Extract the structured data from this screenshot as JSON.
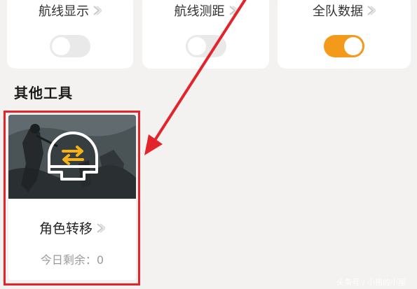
{
  "toggles": [
    {
      "label": "航线显示",
      "state": "off"
    },
    {
      "label": "航线测距",
      "state": "off"
    },
    {
      "label": "全队数据",
      "state": "on"
    }
  ],
  "section": {
    "title": "其他工具"
  },
  "tool": {
    "label": "角色转移",
    "remaining": "今日剩余：0"
  },
  "watermark": "头条号 / 小猪的小屋",
  "colors": {
    "accent": "#f39a1a",
    "highlight": "#e3242b",
    "background": "#f3f2f0"
  },
  "icons": {
    "chevron": "chevron-right-icon",
    "transfer": "helmet-transfer-icon"
  }
}
